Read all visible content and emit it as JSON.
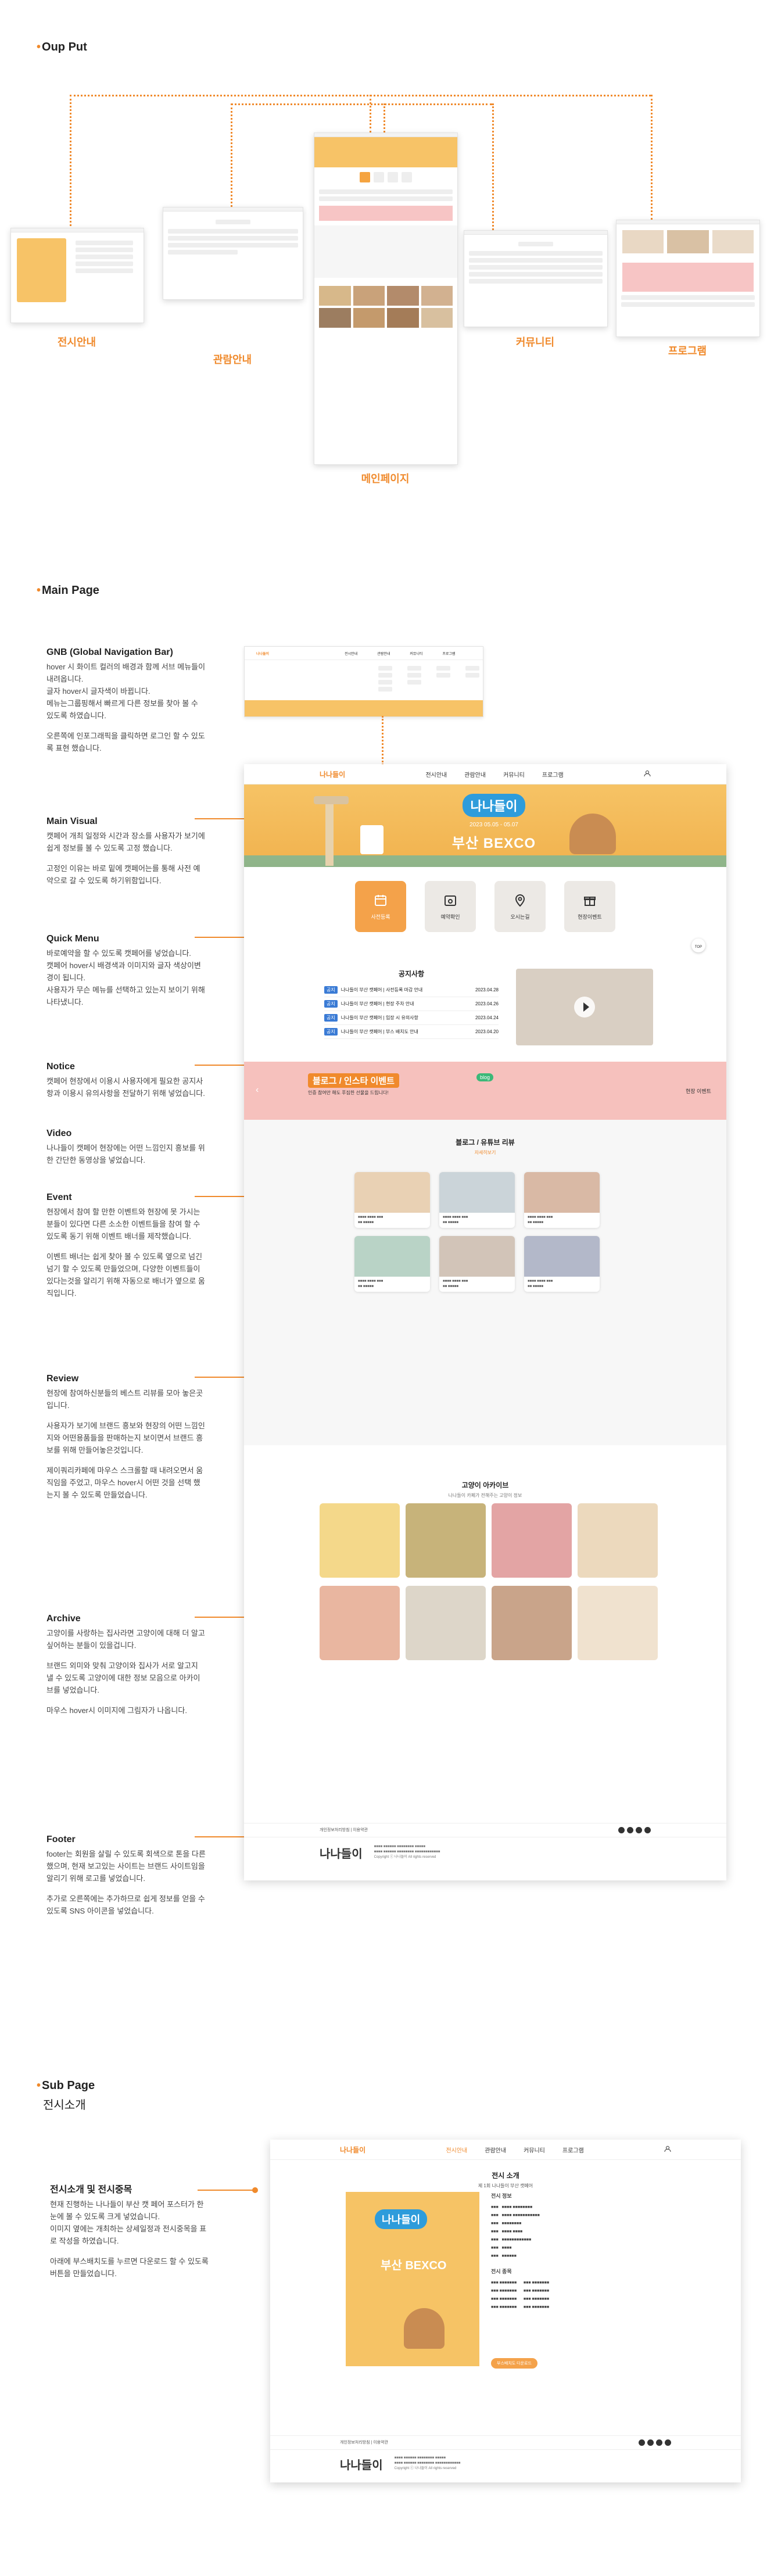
{
  "sections": {
    "output": "Oup Put",
    "main_page": "Main Page",
    "sub_page": "Sub Page",
    "sub_page_sub": "전시소개"
  },
  "output_labels": {
    "exhibition": "전시안내",
    "visit": "관람안내",
    "main": "메인페이지",
    "community": "커뮤니티",
    "program": "프로그램"
  },
  "descriptions": {
    "gnb": {
      "title": "GNB (Global Navigation Bar)",
      "p1": "hover 시 화이트 컬러의 배경과 함께 서브 메뉴들이 내려옵니다.",
      "p1b": "글자 hover시 글자색이 바뀝니다.",
      "p1c": "메뉴는그룹핑해서 빠르게 다른 정보를 찾아 볼 수 있도록 하였습니다.",
      "p2": "오른쪽에 인포그래픽을 클릭하면 로그인 할 수 있도록 표현 했습니다."
    },
    "main_visual": {
      "title": "Main Visual",
      "p1": "캣페어 개최 일정와 시간과 장소를 사용자가 보기에 쉽게 정보를 볼 수 있도록 고정 했습니다.",
      "p2": "고정인 이유는 바로 밑에 캣페어는를 통해 사전 예약으로 갈 수 있도록 하기위함입니다."
    },
    "quick_menu": {
      "title": "Quick Menu",
      "p1": "바로예약을 할 수 있도록 캣페어를 넣었습니다.",
      "p2": "캣페어 hover시 배경색과 이미지와 글자 색상이변경이 됩니다.",
      "p3": "사용자가 무슨 메뉴를 선택하고 있는지 보이기 위해 나타냈니다."
    },
    "notice": {
      "title": "Notice",
      "p1": "캣페어 현장에서 이용시 사용자에게 필요한 공지사항과 이용시 유의사항을 전달하기 위해 넣었습니다."
    },
    "video": {
      "title": "Video",
      "p1": "나나들이 캣페어 현장에는 어떤 느낌인지 흥보를 위한 간단한 동영상을 넣었습니다."
    },
    "event": {
      "title": "Event",
      "p1": "현장에서 참여 할 만한 이벤트와 현장에 못 가시는분들이 있다면 다른 소소한 이벤트들을 참여 할 수 있도록 동기 위해 이벤트 배너를 제작했습니다.",
      "p2": "이벤트 배너는 쉽게 찾아 볼 수 있도록 옆으로 넘긴 넘기 할 수 있도록 만들었으며, 다양한 이벤트들이 있다는것을 알리기 위해 자동으로 배너가 옆으로 움직입니다."
    },
    "review": {
      "title": "Review",
      "p1": "현장에 참여하신분들의 베스트 리뷰를 모아 놓은곳 입니다.",
      "p2": "사용자가 보기에 브랜드 흥보와 현장의 어떤 느낌인지와 어떤용품들을 판매하는지 보이면서 브랜드 흥보를 위해 만들어놓은것입니다.",
      "p3": "제이쿼리카페에 마우스 스크롤할 때 내려오면서 움직임을 주었고, 마우스 hover시 어떤 것을 선택 했는지 볼 수 있도록 만들었습니다."
    },
    "archive": {
      "title": "Archive",
      "p1": "고양이를 사랑하는 집사라면 고양이에 대해 더 알고 싶어하는 분들이 있을겁니다.",
      "p2": "브랜드 외미와 맞춰 고양이와 집사가 서로 알고지 낼 수 있도록 고양이에 대한 정보 모음으로 아카이브를 넣었습니다.",
      "p3": "마우스 hover시 이미지에 그림자가 나옵니다."
    },
    "footer": {
      "title": "Footer",
      "p1": "footer는 회원을 살릴 수 있도록 회색으로 톤을 다른 했으며, 현재 보고있는 사이트는 브랜드 사이트임을 알리기 위해 로고를 넣었습니다.",
      "p2": "추가로 오른쪽에는 추가하므로 쉽게 정보를 얻을 수 있도록 SNS 아이콘을 넣었습니다."
    },
    "exhibit_intro": {
      "title": "전시소개 및 전시중목",
      "p1": "현재 진행하는 나나들이 부산 캣 페어 포스터가 한눈에 볼 수 있도록 크게 넣었습니다.",
      "p2": "이미지 옆에는 개최하는 상세일정과 전시중목을 표로 작성을 하였습니다.",
      "p3": "아래에 부스배치도를 누르면 다운로드 할 수 있도록 버튼을 만들었습니다."
    }
  },
  "site": {
    "logo": "나나들이",
    "nav": [
      "전시안내",
      "관람안내",
      "커뮤니티",
      "프로그램"
    ],
    "hero": {
      "badge": "나나들이",
      "date": "2023 05.05 - 05.07",
      "place": "부산 BEXCO"
    },
    "quick_menu": [
      "사전등록",
      "예약확인",
      "오시는길",
      "현장이벤트"
    ],
    "top_label": "TOP",
    "notice": {
      "title": "공지사항",
      "rows": [
        {
          "tag": "공지",
          "text": "나나들이 부산 캣페어 | 사전등록 마감 안내",
          "date": "2023.04.28"
        },
        {
          "tag": "공지",
          "text": "나나들이 부산 캣페어 | 현장 주차 안내",
          "date": "2023.04.26"
        },
        {
          "tag": "공지",
          "text": "나나들이 부산 캣페어 | 입장 시 유의사항",
          "date": "2023.04.24"
        },
        {
          "tag": "공지",
          "text": "나나들이 부산 캣페어 | 부스 배치도 안내",
          "date": "2023.04.20"
        }
      ]
    },
    "event": {
      "title": "블로그 / 인스타 이벤트",
      "sub": "인증 참여만 해도 푸짐한 선물을 드립니다!",
      "badge": "blog",
      "side": "현장 이벤트"
    },
    "review": {
      "title": "블로그 / 유튜브 리뷰",
      "more": "자세히보기"
    },
    "archive": {
      "title": "고양이 아카이브",
      "sub": "나나들이 카페가 전해주는 고양이 정보"
    },
    "footer": {
      "links": "개인정보처리방침 | 이용약관",
      "logo": "나나들이",
      "copy": "Copyright ⓒ 나나들이 All rights reserved"
    }
  },
  "sub_site": {
    "title": "전시 소개",
    "subtitle": "제 1회 나나들이 부산 캣페어",
    "info_title": "전시 정보",
    "section_title": "전시 종목",
    "button": "부스배치도 다운로드"
  },
  "colors": {
    "accent": "#f08a2c",
    "hero": "#f7c367",
    "page_bg": "#ffffff"
  }
}
